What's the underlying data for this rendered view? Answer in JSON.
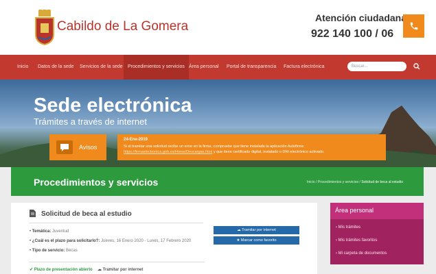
{
  "header": {
    "brand": "Cabildo de La Gomera",
    "contact_title": "Atención ciudadana",
    "contact_phone": "922 140 100 / 06"
  },
  "nav": {
    "items": [
      {
        "label": "Inicio"
      },
      {
        "label": "Datos de la sede"
      },
      {
        "label": "Servicios de la sede"
      },
      {
        "label": "Procedimientos y servicios"
      },
      {
        "label": "Área personal"
      },
      {
        "label": "Portal de transparencia"
      },
      {
        "label": "Factura electrónica"
      }
    ],
    "search_placeholder": "Buscar..."
  },
  "hero": {
    "title": "Sede electrónica",
    "subtitle": "Trámites a través de internet",
    "avisos_label": "Avisos",
    "notice_date": "24-Ene-2019",
    "notice_text_1": "Si al tramitar una solicitud recibe un error en la firma, compruebe que tiene instalada la aplicación Autofirma",
    "notice_link": "https://firmaelectronica.gob.es/Home/Descargas.html",
    "notice_text_2": " y que tiene certificado digital, instalado o DNI electrónico activado."
  },
  "section": {
    "title": "Procedimientos y servicios",
    "crumb_1": "Inicio",
    "crumb_2": "Procedimientos y servicios",
    "crumb_current": "Solicitud de beca al estudio"
  },
  "card": {
    "title": "Solicitud de beca al estudio",
    "fields": [
      {
        "label": "Temática:",
        "value": "Juventud"
      },
      {
        "label": "¿Cuál es el plazo para solicitarlo?:",
        "value": "Jueves, 16 Enero 2020 - Lunes, 17 Febrero 2020"
      },
      {
        "label": "Tipo de servicio:",
        "value": "Becas"
      }
    ],
    "btn_tramitar": "Tramitar por internet",
    "btn_favorito": "Marcar como favorito",
    "status_plazo": "Plazo de presentación abierto",
    "status_tramitar": "Tramitar por internet"
  },
  "side": {
    "title": "Área personal",
    "items": [
      {
        "label": "Mis trámites"
      },
      {
        "label": "Mis trámites favoritos"
      },
      {
        "label": "Mi carpeta de documentos"
      }
    ]
  },
  "colors": {
    "brand_red": "#c2392f",
    "accent_orange": "#f08a1c",
    "section_green": "#2e9a3e",
    "button_blue": "#2569a8",
    "side_magenta": "#c2307b"
  }
}
